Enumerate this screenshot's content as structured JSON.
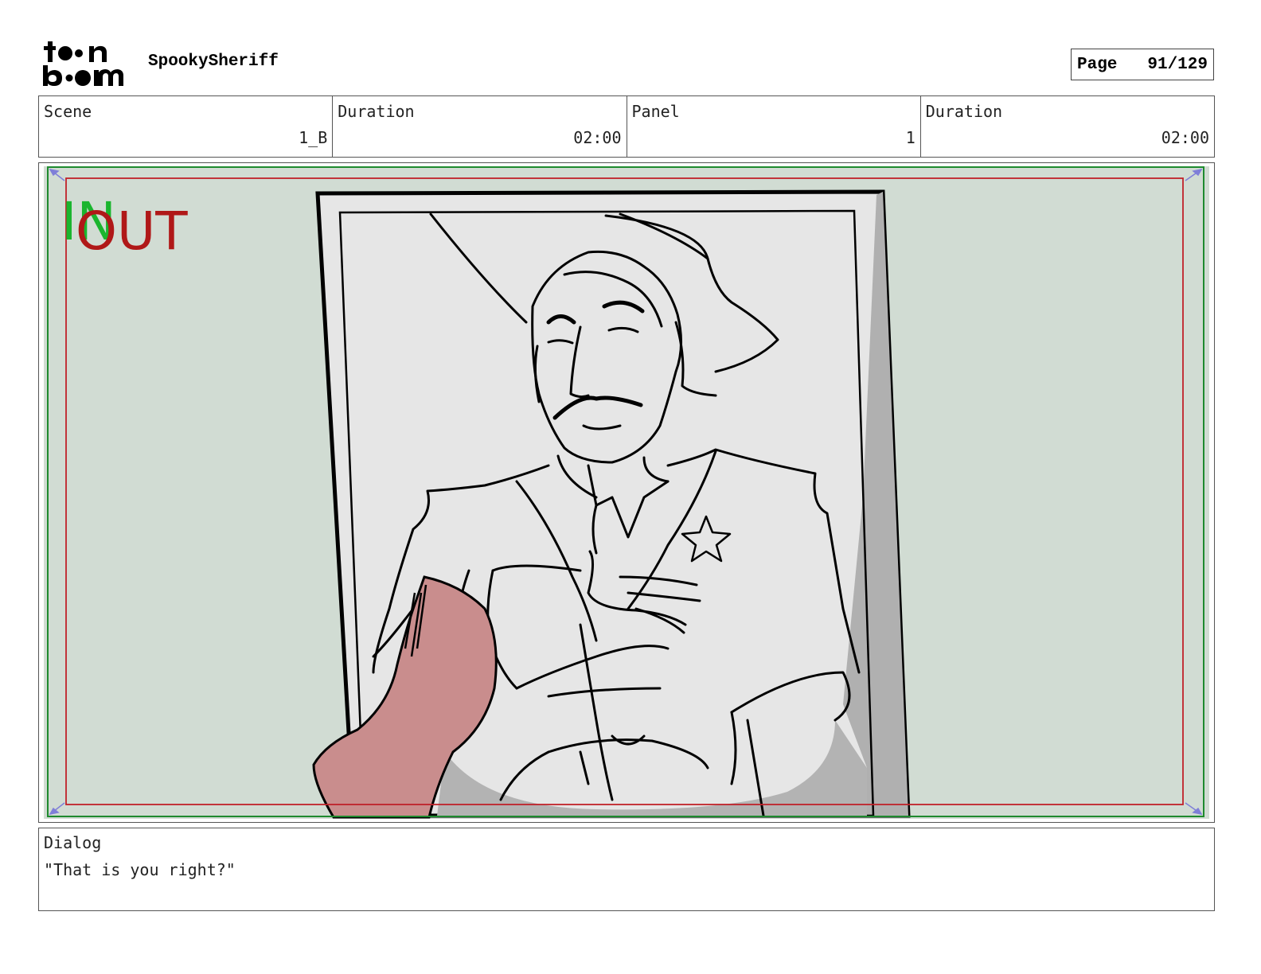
{
  "header": {
    "project_name": "SpookySheriff",
    "page_label": "Page",
    "page_number": "91/129"
  },
  "info": {
    "scene_label": "Scene",
    "scene_value": "1_B",
    "scene_duration_label": "Duration",
    "scene_duration_value": "02:00",
    "panel_label": "Panel",
    "panel_value": "1",
    "panel_duration_label": "Duration",
    "panel_duration_value": "02:00"
  },
  "panel": {
    "in_marker": "IN",
    "out_marker": "OUT",
    "background_color": "#d1dcd3",
    "safe_frame_green": "#1e8a2e",
    "safe_frame_red": "#c0222a",
    "highlight_color": "#c98d8d"
  },
  "dialog": {
    "label": "Dialog",
    "text": "\"That is you right?\""
  }
}
